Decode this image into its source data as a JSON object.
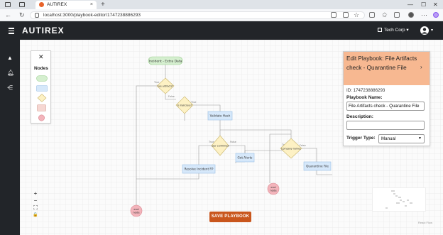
{
  "browser": {
    "tab_title": "AUTIREX",
    "tab_close": "×",
    "new_tab": "+",
    "url": "localhost:3000/playbook-editor/1747238886293",
    "window_controls": [
      "—",
      "☐",
      "✕"
    ]
  },
  "header": {
    "brand": "AUTIREX",
    "company": "Tech Corp ▾",
    "user_caret": "▾"
  },
  "rail": {
    "icons": [
      "warning-icon",
      "bell-icon",
      "share-nodes-icon"
    ]
  },
  "palette": {
    "close": "✕",
    "title": "Nodes",
    "items": [
      {
        "shape": "start",
        "color": "#d5efcf"
      },
      {
        "shape": "action",
        "color": "#d6e8fa"
      },
      {
        "shape": "decision",
        "color": "#fdf1c4"
      },
      {
        "shape": "process",
        "color": "#f6d7d2"
      },
      {
        "shape": "end",
        "color": "#f3b4bb"
      }
    ]
  },
  "flow": {
    "nodes": {
      "start": "Incident - Extra Data",
      "d1": "has artifacts?",
      "d2": "is malicious?",
      "validate": "Validate Hash",
      "d3": "user confirmed",
      "alerts": "Get Alerts",
      "resolve": "Resolve Incident FP",
      "d4": "Company names",
      "quarantine": "Quarantine File",
      "end1": "end node",
      "end2": "end node"
    },
    "edge_labels": {
      "true": "True",
      "false": "False"
    }
  },
  "zoom": [
    "+",
    "−",
    "⛶",
    "🔒"
  ],
  "attribution": "React Flow",
  "save_button": "SAVE PLAYBOOK",
  "panel": {
    "title": "Edit Playbook: File Artifacts check - Quarantine File",
    "chevron": "›",
    "id_text": "ID: 1747238886293",
    "name_label": "Playbook Name:",
    "name_value": "File Artifacts check - Quarantine File",
    "description_label": "Description:",
    "description_value": "",
    "trigger_label": "Trigger Type:",
    "trigger_value": "Manual"
  }
}
